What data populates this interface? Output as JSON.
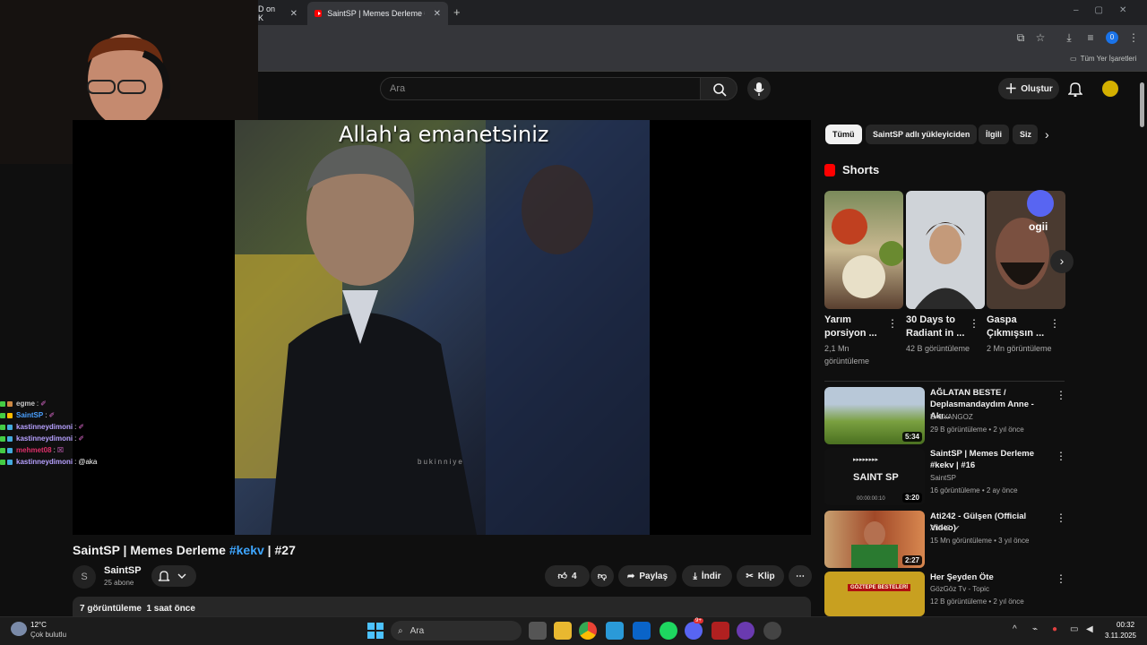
{
  "browser": {
    "tabs": [
      {
        "label": "D on K",
        "active": false
      },
      {
        "label": "SaintSP | Memes Derleme #kekv",
        "active": true
      }
    ],
    "new_tab": "+",
    "bookmarks_label": "Tüm Yer İşaretleri",
    "profile_badge": "0"
  },
  "youtube": {
    "search_placeholder": "Ara",
    "create_label": "Oluştur",
    "video": {
      "caption": "Allah'a emanetsiniz",
      "watermark": "bukinniye",
      "title_prefix": "SaintSP | Memes Derleme ",
      "title_hashtag": "#kekv",
      "title_suffix": " | #27",
      "channel_avatar": "S",
      "channel_name": "SaintSP",
      "subscribers": "25 abone",
      "likes": "4",
      "share_label": "Paylaş",
      "download_label": "İndir",
      "clip_label": "Klip",
      "description_meta": "7 görüntüleme  1 saat önce"
    },
    "chips": [
      "Tümü",
      "SaintSP adlı yükleyiciden",
      "İlgili",
      "Siz"
    ],
    "shorts_title": "Shorts",
    "shorts": [
      {
        "title": "Yarım porsiyon ...",
        "views": "2,1 Mn görüntüleme"
      },
      {
        "title": "30 Days to Radiant in ...",
        "views": "42 B görüntüleme"
      },
      {
        "title": "Gaspa Çıkmışsın ...",
        "views": "2 Mn görüntüleme",
        "overlay": "ogii"
      }
    ],
    "recommended": [
      {
        "title": "AĞLATAN BESTE / Deplasmandaydım Anne - Akı...",
        "channel": "BALYANGOZ",
        "meta": "29 B görüntüleme • 2 yıl önce",
        "duration": "5:34",
        "color": "#8fb060"
      },
      {
        "title": "SaintSP | Memes Derleme #kekv | #16",
        "channel": "SaintSP",
        "meta": "16 görüntüleme • 2 ay önce",
        "duration": "3:20",
        "thumb_text": "SAINT SP",
        "thumb_sub": "▸▸▸▸▸▸▸▸",
        "thumb_time": "00:00:00:10",
        "color": "#111111"
      },
      {
        "title": "Ati242 - Gülşen (Official Video)",
        "channel": "Ati242",
        "meta": "15 Mn görüntüleme • 3 yıl önce",
        "duration": "2:27",
        "color": "#a04828"
      },
      {
        "title": "Her Şeyden Öte",
        "channel": "GözGöz Tv - Topic",
        "meta": "12 B görüntüleme • 2 yıl önce",
        "thumb_text": "GÖZTEPE BESTELERİ",
        "color": "#c8a020"
      }
    ]
  },
  "chat": [
    {
      "user": "egme",
      "msg": "✐",
      "color": "#c8c8c8"
    },
    {
      "user": "SaintSP",
      "msg": "✐",
      "color": "#4aa0ff"
    },
    {
      "user": "kastinneydimoni",
      "msg": "✐",
      "color": "#b7a1ff"
    },
    {
      "user": "kastinneydimoni",
      "msg": "✐",
      "color": "#b7a1ff"
    },
    {
      "user": "mehmet08",
      "msg": "☒",
      "color": "#e0306a"
    },
    {
      "user": "kastinneydimoni",
      "msg": "@aka",
      "color": "#b7a1ff"
    }
  ],
  "taskbar": {
    "weather_temp": "12°C",
    "weather_desc": "Çok bulutlu",
    "search_label": "Ara",
    "time": "00:32",
    "date": "3.11.2025",
    "discord_badge": "9+"
  }
}
